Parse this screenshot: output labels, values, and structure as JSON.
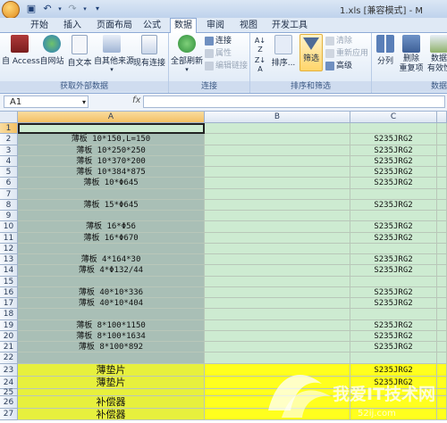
{
  "window": {
    "title": "1.xls  [兼容模式] - M"
  },
  "tabs": [
    "开始",
    "插入",
    "页面布局",
    "公式",
    "数据",
    "审阅",
    "视图",
    "开发工具"
  ],
  "active_tab": "数据",
  "ribbon": {
    "external_data": {
      "label": "获取外部数据",
      "buttons": [
        "自 Access",
        "自网站",
        "自文本",
        "自其他来源",
        "现有连接"
      ]
    },
    "connections": {
      "label": "连接",
      "refresh": "全部刷新",
      "connect": "连接",
      "properties": "属性",
      "edit_links": "编辑链接"
    },
    "sort_filter": {
      "label": "排序和筛选",
      "sort": "排序...",
      "filter": "筛选",
      "clear": "清除",
      "reapply": "重新应用",
      "advanced": "高级"
    },
    "tools": {
      "label": "数据",
      "split": "分列",
      "remove_dup_1": "删除",
      "remove_dup_2": "重复项",
      "validate_1": "数据",
      "validate_2": "有效性"
    }
  },
  "formula_bar": {
    "name_box": "A1",
    "fx": "fx",
    "formula": ""
  },
  "columns": [
    "A",
    "B",
    "C"
  ],
  "rows": [
    {
      "n": "1",
      "a": "",
      "c": ""
    },
    {
      "n": "2",
      "a": "薄板 10*150,L=150",
      "c": "S235JRG2"
    },
    {
      "n": "3",
      "a": "薄板 10*250*250",
      "c": "S235JRG2"
    },
    {
      "n": "4",
      "a": "薄板 10*370*200",
      "c": "S235JRG2"
    },
    {
      "n": "5",
      "a": "薄板 10*384*875",
      "c": "S235JRG2"
    },
    {
      "n": "6",
      "a": "薄板 10*Φ645",
      "c": "S235JRG2"
    },
    {
      "n": "7",
      "a": "",
      "c": ""
    },
    {
      "n": "8",
      "a": "薄板 15*Φ645",
      "c": "S235JRG2"
    },
    {
      "n": "9",
      "a": "",
      "c": ""
    },
    {
      "n": "10",
      "a": "薄板 16*Φ56",
      "c": "S235JRG2"
    },
    {
      "n": "11",
      "a": "薄板 16*Φ670",
      "c": "S235JRG2"
    },
    {
      "n": "12",
      "a": "",
      "c": ""
    },
    {
      "n": "13",
      "a": "薄板 4*164*30",
      "c": "S235JRG2"
    },
    {
      "n": "14",
      "a": "薄板 4*Φ132/44",
      "c": "S235JRG2"
    },
    {
      "n": "15",
      "a": "",
      "c": ""
    },
    {
      "n": "16",
      "a": "薄板 40*10*336",
      "c": "S235JRG2"
    },
    {
      "n": "17",
      "a": "薄板 40*10*404",
      "c": "S235JRG2"
    },
    {
      "n": "18",
      "a": "",
      "c": ""
    },
    {
      "n": "19",
      "a": "薄板 8*100*1150",
      "c": "S235JRG2"
    },
    {
      "n": "20",
      "a": "薄板 8*100*1634",
      "c": "S235JRG2"
    },
    {
      "n": "21",
      "a": "薄板 8*100*892",
      "c": "S235JRG2"
    },
    {
      "n": "22",
      "a": "",
      "c": ""
    },
    {
      "n": "23",
      "a": "薄垫片",
      "c": "S235JRG2"
    },
    {
      "n": "24",
      "a": "薄垫片",
      "c": "S235JRG2"
    },
    {
      "n": "25",
      "a": "",
      "c": ""
    },
    {
      "n": "26",
      "a": "补偿器",
      "c": ""
    },
    {
      "n": "27",
      "a": "补偿器",
      "c": ""
    }
  ],
  "highlighted_rows": [
    "23",
    "24",
    "25",
    "26",
    "27"
  ],
  "colors": {
    "col_a": "#a9bfb6",
    "col_fill": "#cdebd1",
    "yellow": "#ffff1e"
  },
  "watermark": {
    "text": "我爱IT技术网",
    "sub": "52ij.com"
  }
}
